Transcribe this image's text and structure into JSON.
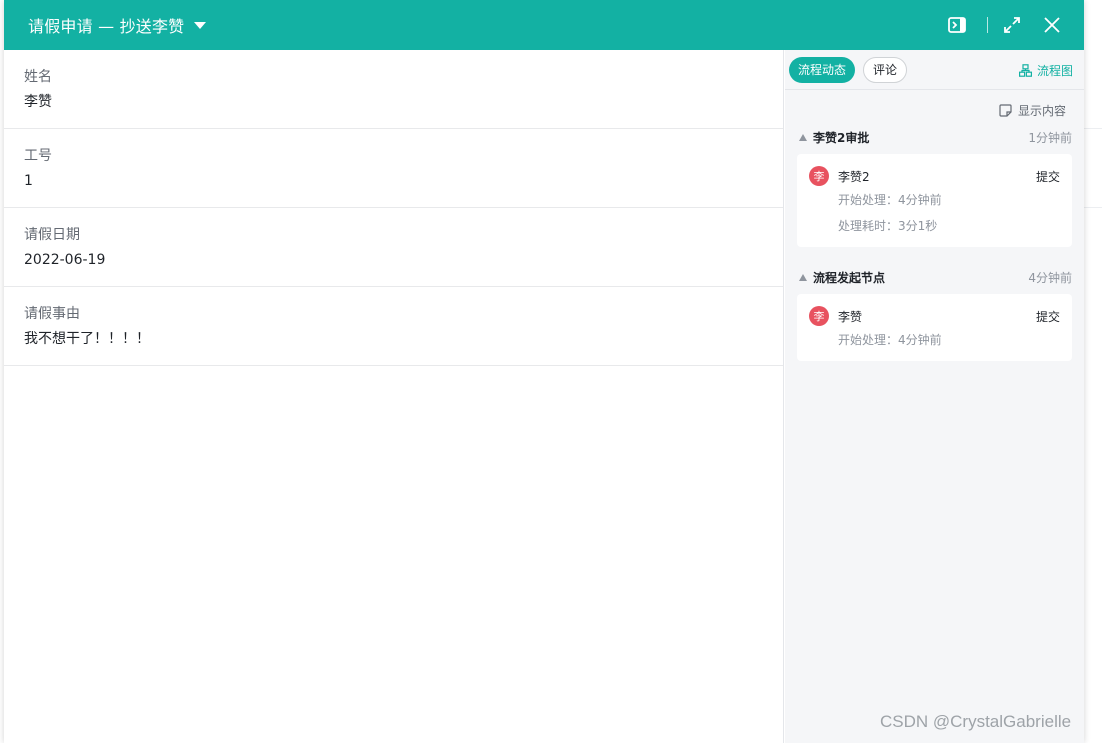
{
  "header": {
    "title": "请假申请 — 抄送李赞",
    "icons": [
      "panel-toggle-icon",
      "expand-icon",
      "close-icon"
    ]
  },
  "form": {
    "fields": [
      {
        "label": "姓名",
        "value": "李赞"
      },
      {
        "label": "工号",
        "value": "1"
      },
      {
        "label": "请假日期",
        "value": "2022-06-19"
      },
      {
        "label": "请假事由",
        "value": "我不想干了！！！！"
      }
    ]
  },
  "side": {
    "tabs": [
      {
        "label": "流程动态",
        "active": true
      },
      {
        "label": "评论",
        "active": false
      }
    ],
    "flowchart_label": "流程图",
    "show_content_label": "显示内容",
    "nodes": [
      {
        "name": "李赞2审批",
        "time": "1分钟前",
        "user": {
          "avatar": "李",
          "name": "李赞2",
          "action": "提交"
        },
        "start_label": "开始处理：",
        "start_value": "4分钟前",
        "duration_label": "处理耗时：",
        "duration_value": "3分1秒"
      },
      {
        "name": "流程发起节点",
        "time": "4分钟前",
        "user": {
          "avatar": "李",
          "name": "李赞",
          "action": "提交"
        },
        "start_label": "开始处理：",
        "start_value": "4分钟前"
      }
    ]
  },
  "watermark": "CSDN @CrystalGabrielle",
  "colors": {
    "accent": "#13b1a3",
    "avatar": "#e8525f",
    "muted": "#8f959e"
  }
}
